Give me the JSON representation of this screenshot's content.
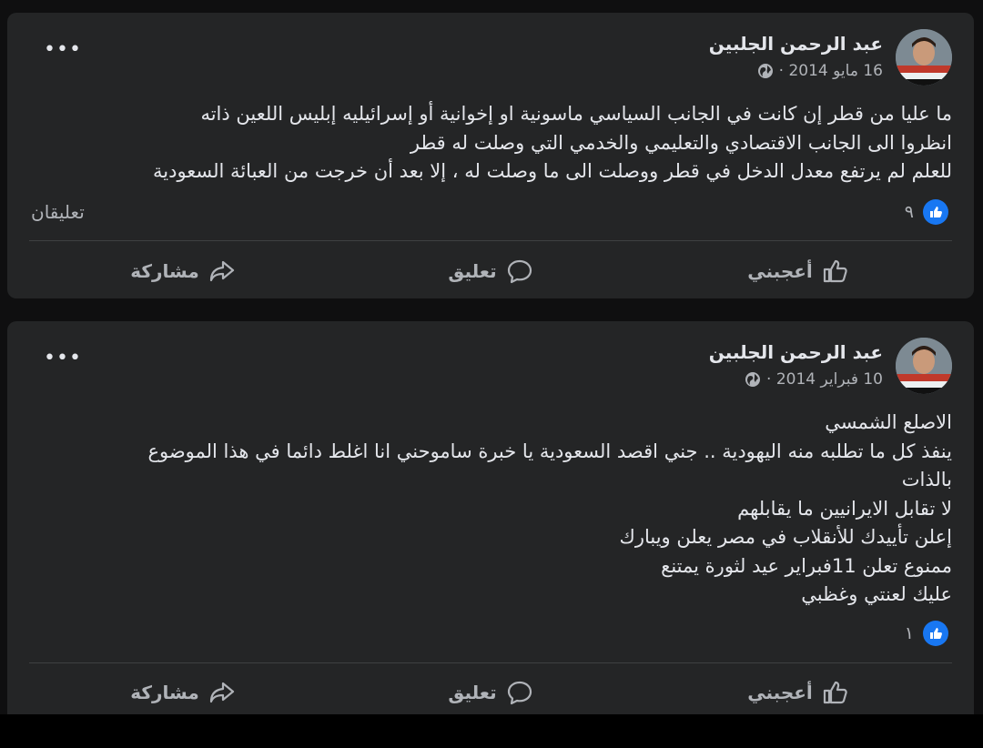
{
  "posts": [
    {
      "author": "عبد الرحمن الجلبين",
      "date": "16 مايو 2014 ·",
      "text_lines": [
        "ما عليا من قطر إن كانت في الجانب السياسي ماسونية او إخوانية أو إسرائيليه إبليس اللعين ذاته",
        "انظروا الى الجانب الاقتصادي والتعليمي والخدمي التي وصلت له قطر",
        "للعلم لم يرتفع معدل الدخل في قطر ووصلت الى ما وصلت له ، إلا بعد أن خرجت من العبائة السعودية"
      ],
      "reactions": "٩",
      "comments": "تعليقان"
    },
    {
      "author": "عبد الرحمن الجلبين",
      "date": "10 فبراير 2014 ·",
      "text_lines": [
        "الاصلع الشمسي",
        "ينفذ كل ما تطلبه منه اليهودية .. جني اقصد السعودية يا خبرة ساموحني انا اغلط دائما في هذا الموضوع",
        "بالذات",
        "لا تقابل الايرانيين ما يقابلهم",
        "إعلن تأييدك للأنقلاب في مصر يعلن ويبارك",
        "ممنوع تعلن 11فبراير عيد لثورة يمتنع",
        "عليك لعنتي وغظبي"
      ],
      "reactions": "١",
      "comments": ""
    }
  ],
  "actions": {
    "like": "أعجبني",
    "comment": "تعليق",
    "share": "مشاركة"
  },
  "more_menu": "•••",
  "colors": {
    "background": "#0f0f10",
    "card": "#242526",
    "primary_text": "#e4e6eb",
    "secondary_text": "#b0b3b8",
    "like_blue": "#1877f2"
  },
  "icons": [
    "globe-icon",
    "like-icon",
    "thumbs-up-icon",
    "comment-icon",
    "share-icon",
    "more-options-icon"
  ]
}
